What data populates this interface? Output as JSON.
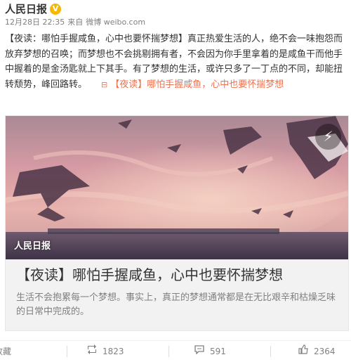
{
  "author": {
    "name": "人民日报",
    "verified_badge": "V"
  },
  "meta": {
    "date": "12月28日 22:35",
    "source_prefix": "来自",
    "source": "微博 weibo.com"
  },
  "post": {
    "text": "【夜读：哪怕手握咸鱼，心中也要怀揣梦想】真正热爱生活的人，绝不会一味抱怨而放弃梦想的召唤；而梦想也不会挑剔拥有者，不会因为你手里拿着的是咸鱼干而他手中握着的是金汤匙就上下其手。有了梦想的生活，或许只多了一丁点的不同，却能扭转颓势，峰回路转。",
    "link_icon": "⊟",
    "link_text": "【夜读】哪怕手握咸鱼，心中也要怀揣梦想"
  },
  "card": {
    "watermark": "人民日报",
    "play_icon": "lightning-icon",
    "play_glyph": "⚡",
    "title": "【夜读】哪怕手握咸鱼，心中也要怀揣梦想",
    "description": "生活不会抱累每一个梦想。事实上，真正的梦想通常都是在无比艰辛和枯燥乏味的日常中完成的。"
  },
  "actions": {
    "favorite": {
      "label": "收藏",
      "icon": "star-icon"
    },
    "repost": {
      "label": "1823",
      "icon": "repost-icon"
    },
    "comment": {
      "label": "591",
      "icon": "comment-icon"
    },
    "like": {
      "label": "2364",
      "icon": "thumbs-up-icon"
    }
  },
  "colors": {
    "link": "#eb7350",
    "text": "#333333",
    "muted": "#808080",
    "verified": "#f7b600"
  }
}
